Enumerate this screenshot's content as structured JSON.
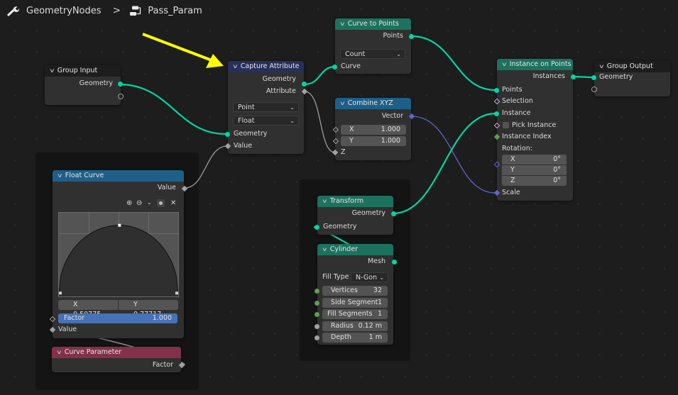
{
  "breadcrumb": {
    "modifier_icon": "wrench-icon",
    "modifier_name": "GeometryNodes",
    "separator": ">",
    "node_tree_icon": "node-tree-icon",
    "node_tree_name": "Pass_Param"
  },
  "annotation": {
    "type": "arrow",
    "color": "#ffff00",
    "points_to": "Capture Attribute"
  },
  "colors": {
    "geometry_socket": "#00d6a3",
    "vector_socket": "#6363c7",
    "float_socket": "#a1a1a1",
    "integer_socket": "#5e9e52",
    "header_geometry": "#1d725e",
    "header_vector": "#1e5f88",
    "header_attribute": "#27305a",
    "header_input": "#83314a",
    "factor_slider": "#4772b3"
  },
  "nodes": {
    "group_input": {
      "title": "Group Input",
      "outputs": [
        "Geometry"
      ]
    },
    "capture_attribute": {
      "title": "Capture Attribute",
      "outputs": [
        "Geometry",
        "Attribute"
      ],
      "domain": "Point",
      "data_type": "Float",
      "inputs": [
        "Geometry",
        "Value"
      ]
    },
    "curve_to_points": {
      "title": "Curve to Points",
      "outputs": [
        "Points"
      ],
      "mode": "Count",
      "inputs": [
        "Curve"
      ]
    },
    "combine_xyz": {
      "title": "Combine XYZ",
      "outputs": [
        "Vector"
      ],
      "fields": [
        {
          "label": "X",
          "value": "1.000"
        },
        {
          "label": "Y",
          "value": "1.000"
        }
      ],
      "inputs": [
        "Z"
      ]
    },
    "instance_on_points": {
      "title": "Instance on Points",
      "outputs": [
        "Instances"
      ],
      "inputs": [
        "Points",
        "Selection",
        "Instance",
        "Pick Instance",
        "Instance Index",
        "Scale"
      ],
      "pick_instance_checked": false,
      "rotation_label": "Rotation:",
      "rotation": [
        {
          "label": "X",
          "value": "0°"
        },
        {
          "label": "Y",
          "value": "0°"
        },
        {
          "label": "Z",
          "value": "0°"
        }
      ]
    },
    "group_output": {
      "title": "Group Output",
      "inputs": [
        "Geometry"
      ]
    },
    "float_curve": {
      "title": "Float Curve",
      "outputs": [
        "Value"
      ],
      "tools": [
        "zoom-in-icon",
        "zoom-out-icon",
        "chevron-down-icon",
        "handle-icon",
        "close-icon"
      ],
      "point_x": "X 0.50775",
      "point_y": "Y 0.77717",
      "factor_label": "Factor",
      "factor_value": "1.000",
      "factor_fill": 1.0,
      "inputs": [
        "Value"
      ],
      "curve_points": [
        [
          0.0,
          0.0
        ],
        [
          0.50775,
          0.77717
        ],
        [
          1.0,
          0.0
        ]
      ]
    },
    "curve_parameter": {
      "title": "Curve Parameter",
      "outputs": [
        "Factor"
      ]
    },
    "transform": {
      "title": "Transform",
      "outputs": [
        "Geometry"
      ],
      "inputs": [
        "Geometry"
      ]
    },
    "cylinder": {
      "title": "Cylinder",
      "outputs": [
        "Mesh"
      ],
      "fill_type_label": "Fill Type",
      "fill_type": "N-Gon",
      "fields": [
        {
          "label": "Vertices",
          "value": "32"
        },
        {
          "label": "Side Segment",
          "value": "1"
        },
        {
          "label": "Fill Segments",
          "value": "1"
        },
        {
          "label": "Radius",
          "value": "0.12 m"
        },
        {
          "label": "Depth",
          "value": "1 m"
        }
      ]
    }
  }
}
